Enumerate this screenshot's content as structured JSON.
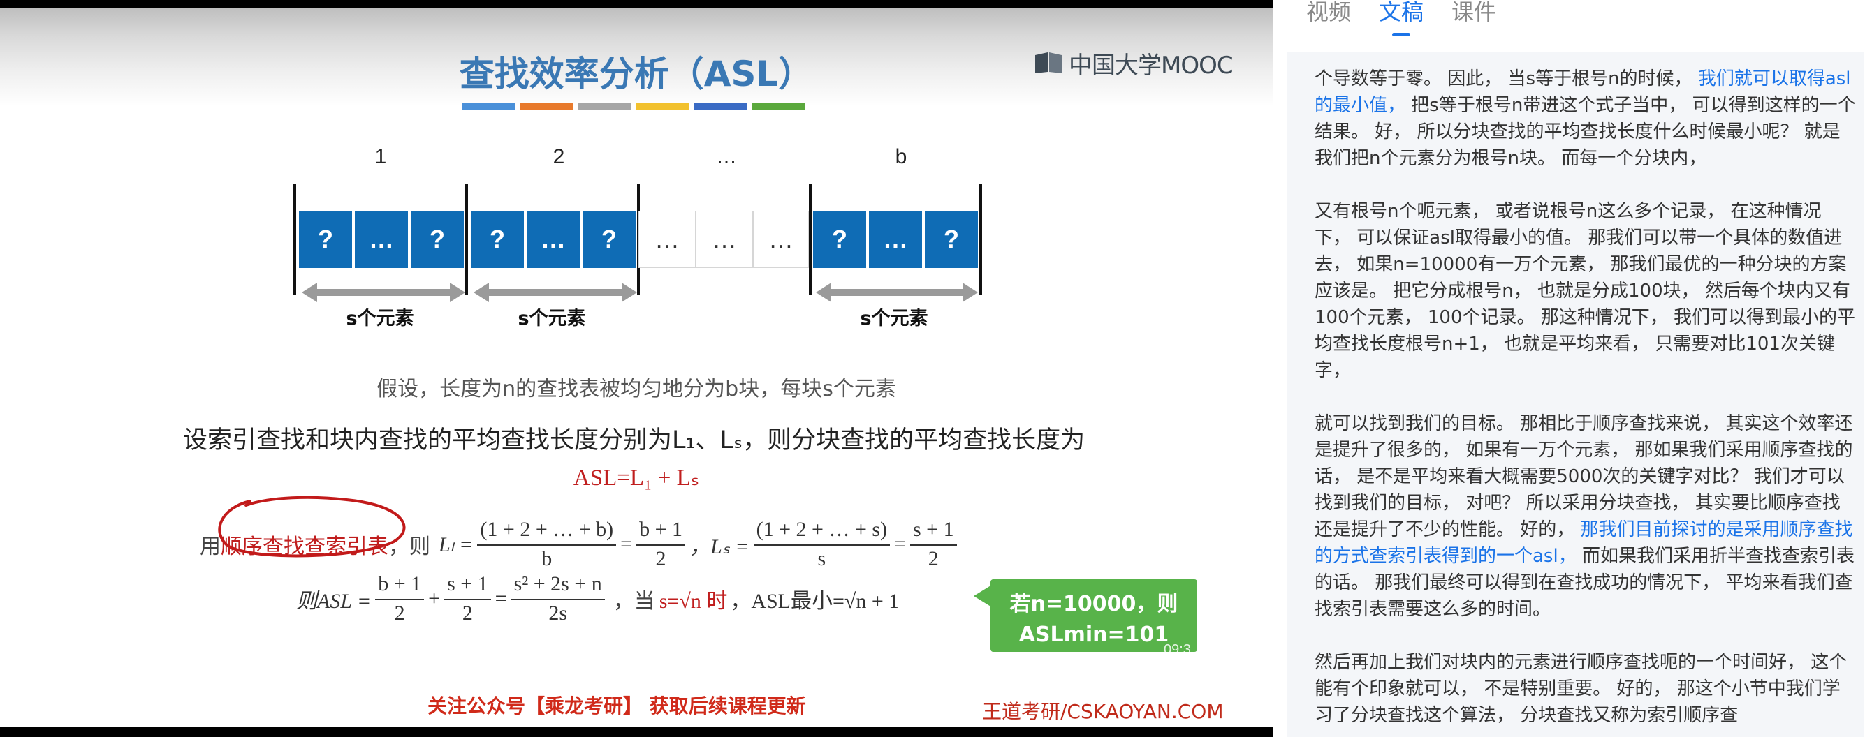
{
  "slide": {
    "title": "查找效率分析（ASL）",
    "title_bar_colors": [
      "#4a90d9",
      "#e87a2c",
      "#a6a6a6",
      "#f2c12e",
      "#3a6bc4",
      "#5aa83c"
    ],
    "logo_text": "中国大学MOOC",
    "block_labels": [
      "1",
      "2",
      "…",
      "b"
    ],
    "cell_q": "?",
    "cell_dots": "…",
    "s_label": "s个元素",
    "assumption": "假设，长度为n的查找表被均匀地分为b块，每块s个元素",
    "main_line": "设索引查找和块内查找的平均查找长度分别为L₁、Lₛ，则分块查找的平均查找长度为",
    "asl_formula": "ASL=L₁ + Lₛ",
    "row1_prefix": "用",
    "row1_circled": "顺序查找查索引表",
    "row1_then": "，则",
    "li_label": "Lₗ =",
    "li_num": "(1 + 2 + … + b)",
    "li_den": "b",
    "li_eq_num": "b + 1",
    "li_eq_den": "2",
    "ls_label": "，Lₛ =",
    "ls_num": "(1 + 2 + … + s)",
    "ls_den": "s",
    "ls_eq_num": "s + 1",
    "ls_eq_den": "2",
    "row2_prefix": "则ASL =",
    "r2_f1_num": "b + 1",
    "r2_f1_den": "2",
    "r2_f2_num": "s + 1",
    "r2_f2_den": "2",
    "r2_f3_num": "s² + 2s + n",
    "r2_f3_den": "2s",
    "r2_when": "，当",
    "r2_cond": "s=√n 时",
    "r2_min": "，ASL最小=√n + 1",
    "callout_line1": "若n=10000，则",
    "callout_line2": "ASLmin=101",
    "timestamp": "09:3",
    "footer_left": "关注公众号【乘龙考研】 获取后续课程更新",
    "footer_right": "王道考研/CSKAOYAN.COM"
  },
  "tabs": [
    "视频",
    "文稿",
    "课件"
  ],
  "active_tab": "文稿",
  "transcript": {
    "p1_a": "个导数等于零。 因此， 当s等于根号n的时候， ",
    "p1_hl": "我们就可以取得asl的最小值，",
    "p1_b": " 把s等于根号n带进这个式子当中， 可以得到这样的一个结果。 好， 所以分块查找的平均查找长度什么时候最小呢？ 就是我们把n个元素分为根号n块。 而每一个分块内，",
    "p2": "又有根号n个呃元素， 或者说根号n这么多个记录， 在这种情况下， 可以保证asl取得最小的值。 那我们可以带一个具体的数值进去， 如果n=10000有一万个元素， 那我们最优的一种分块的方案应该是。 把它分成根号n， 也就是分成100块， 然后每个块内又有100个元素， 100个记录。 那这种情况下， 我们可以得到最小的平均查找长度根号n+1， 也就是平均来看， 只需要对比101次关键字，",
    "p3_a": "就可以找到我们的目标。 那相比于顺序查找来说， 其实这个效率还是提升了很多的， 如果有一万个元素， 那如果我们采用顺序查找的话， 是不是平均来看大概需要5000次的关键字对比？ 我们才可以找到我们的目标， 对吧？ 所以采用分块查找， 其实要比顺序查找还是提升了不少的性能。 好的， ",
    "p3_hl": "那我们目前探讨的是采用顺序查找的方式查索引表得到的一个asl，",
    "p3_b": " 而如果我们采用折半查找查索引表的话。 那我们最终可以得到在查找成功的情况下， 平均来看我们查找索引表需要这么多的时间。",
    "p4": "然后再加上我们对块内的元素进行顺序查找呃的一个时间好， 这个能有个印象就可以， 不是特别重要。 好的， 那这个小节中我们学习了分块查找这个算法， 分块查找又称为索引顺序查"
  }
}
